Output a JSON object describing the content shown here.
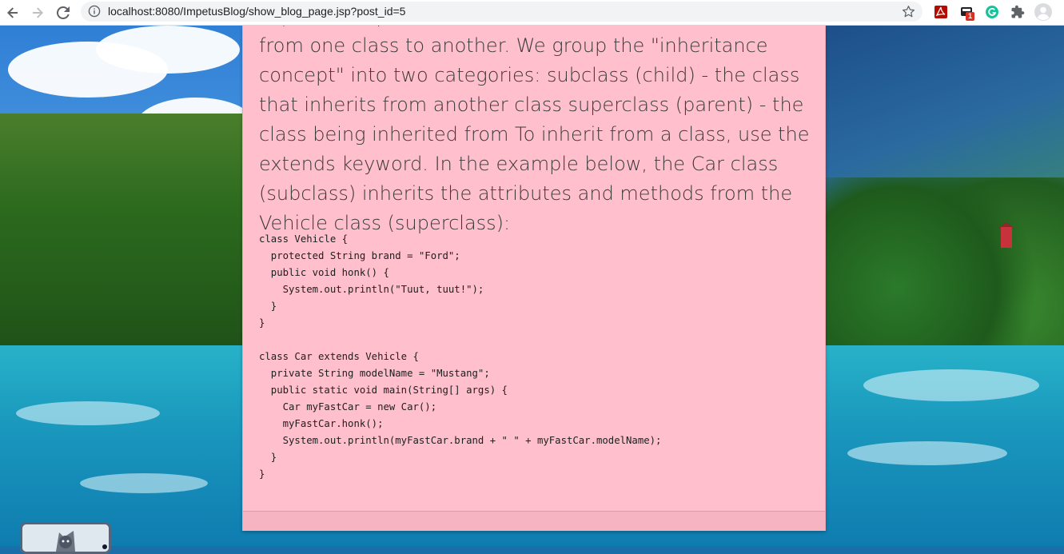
{
  "browser": {
    "url": "localhost:8080/ImpetusBlog/show_blog_page.jsp?post_id=5",
    "extension_badge": "1"
  },
  "post": {
    "paragraph": "In Java, it is possible to inherit attributes and methods from one class to another. We group the \"inheritance concept\" into two categories: subclass (child) - the class that inherits from another class superclass (parent) - the class being inherited from To inherit from a class, use the extends keyword. In the example below, the Car class (subclass) inherits the attributes and methods from the Vehicle class (superclass):",
    "code": "class Vehicle {\n  protected String brand = \"Ford\";\n  public void honk() {\n    System.out.println(\"Tuut, tuut!\");\n  }\n}\n\nclass Car extends Vehicle {\n  private String modelName = \"Mustang\";\n  public static void main(String[] args) {\n    Car myFastCar = new Car();\n    myFastCar.honk();\n    System.out.println(myFastCar.brand + \" \" + myFastCar.modelName);\n  }\n}"
  },
  "icons": {
    "back": "arrow-left-icon",
    "forward": "arrow-right-icon",
    "reload": "reload-icon",
    "site_info": "info-icon",
    "bookmark": "star-icon",
    "pdf_extension": "adobe-pdf-icon",
    "badge_extension": "extension-badge-icon",
    "grammarly": "grammarly-icon",
    "extensions": "puzzle-icon",
    "profile": "profile-avatar-icon"
  },
  "colors": {
    "card_background": "#ffbfcc",
    "card_footer": "#f6b3c1",
    "text": "#3a3a3a"
  }
}
